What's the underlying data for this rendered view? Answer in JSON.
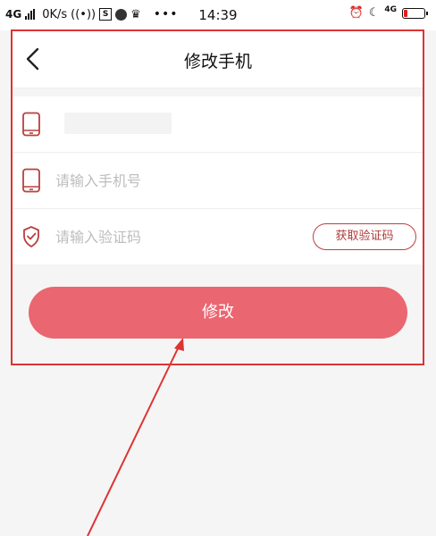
{
  "status_bar": {
    "network": "4G",
    "speed": "0K/s",
    "app_badge": "S",
    "time": "14:39",
    "network_right": "4G",
    "icons": [
      "signal-icon",
      "hotspot-icon",
      "s-badge-icon",
      "ball-icon",
      "crown-icon",
      "more-dots-icon",
      "alarm-icon",
      "moon-icon",
      "battery-icon"
    ]
  },
  "header": {
    "title": "修改手机",
    "back_icon": "chevron-left-icon"
  },
  "form": {
    "current_phone_icon": "phone-icon",
    "new_phone_placeholder": "请输入手机号",
    "new_phone_icon": "phone-icon",
    "code_placeholder": "请输入验证码",
    "code_icon": "shield-check-icon",
    "get_code_label": "获取验证码"
  },
  "actions": {
    "submit_label": "修改"
  },
  "colors": {
    "accent": "#ea6670",
    "icon": "#b94040",
    "annotation": "#dd3333"
  }
}
